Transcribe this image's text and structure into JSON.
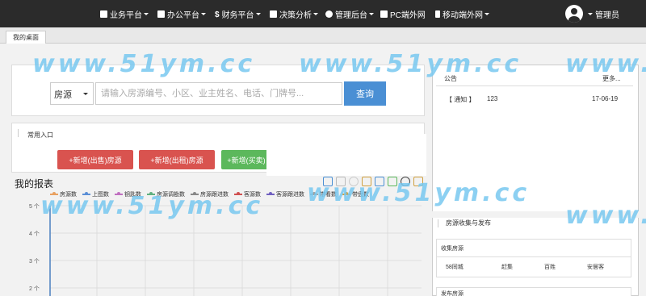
{
  "nav": {
    "items": [
      {
        "label": "业务平台"
      },
      {
        "label": "办公平台"
      },
      {
        "label": "财务平台"
      },
      {
        "label": "决策分析"
      },
      {
        "label": "管理后台"
      },
      {
        "label": "PC端外网"
      },
      {
        "label": "移动端外网"
      }
    ],
    "user_label": "管理员"
  },
  "tabs": {
    "active": "我的桌面"
  },
  "search": {
    "type_value": "房源",
    "placeholder": "请输入房源编号、小区、业主姓名、电话、门牌号...",
    "button_label": "查询"
  },
  "quick": {
    "title": "常用入口",
    "buttons": [
      "+新增(出售)房源",
      "+新增(出租)房源",
      "+新增(买卖)"
    ]
  },
  "report": {
    "title": "我的报表",
    "legend": [
      "房源数",
      "上图数",
      "钥匙数",
      "房源调勘数",
      "房源跟进数",
      "客源数",
      "客源跟进数",
      "带看数",
      "带盘数"
    ],
    "legend_colors": [
      "#e8a060",
      "#5b8fd6",
      "#c070c0",
      "#60b080",
      "#888888",
      "#d05050",
      "#7060c0",
      "#a0a0a0",
      "#d0a040"
    ],
    "y_ticks": [
      "5 个",
      "4 个",
      "3 个",
      "2 个"
    ]
  },
  "chart_data": {
    "type": "line",
    "title": "",
    "series": [
      {
        "name": "房源数",
        "values": []
      },
      {
        "name": "上图数",
        "values": []
      },
      {
        "name": "钥匙数",
        "values": []
      },
      {
        "name": "房源调勘数",
        "values": []
      },
      {
        "name": "房源跟进数",
        "values": []
      },
      {
        "name": "客源数",
        "values": []
      },
      {
        "name": "客源跟进数",
        "values": []
      },
      {
        "name": "带看数",
        "values": []
      },
      {
        "name": "带盘数",
        "values": []
      }
    ],
    "ylim": [
      0,
      5
    ],
    "y_ticks": [
      "5 个",
      "4 个",
      "3 个",
      "2 个"
    ],
    "grid": true
  },
  "notice": {
    "title": "公告",
    "more": "更多...",
    "rows": [
      {
        "tag": "【 通知 】",
        "text": "123",
        "date": "17-06-19"
      }
    ]
  },
  "collect": {
    "title": "房源收集与发布",
    "sub_title": "收集房源",
    "sources": [
      "58同城",
      "赶集",
      "百姓",
      "安居客"
    ],
    "publish_title": "发布房源"
  },
  "watermark": "www.51ym.cc"
}
